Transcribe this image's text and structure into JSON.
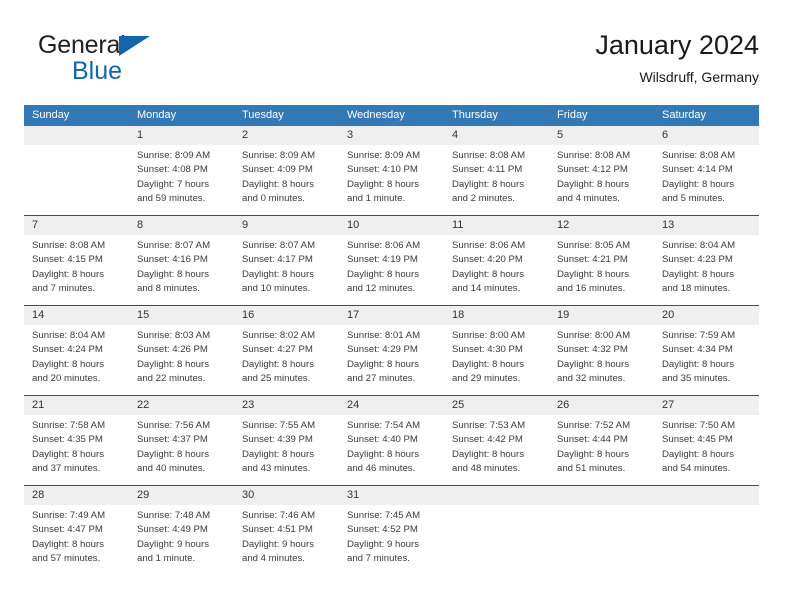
{
  "brand": {
    "word1": "General",
    "word2": "Blue",
    "flag_color": "#1266ab"
  },
  "header": {
    "title": "January 2024",
    "subtitle": "Wilsdruff, Germany"
  },
  "theme": {
    "header_blue": "#3379b8",
    "rule_blue": "#19598f",
    "daynum_band": "#efefef"
  },
  "calendar": {
    "weekdays": [
      "Sunday",
      "Monday",
      "Tuesday",
      "Wednesday",
      "Thursday",
      "Friday",
      "Saturday"
    ],
    "weeks": [
      [
        {
          "day": "",
          "sunrise": "",
          "sunset": "",
          "daylight1": "",
          "daylight2": ""
        },
        {
          "day": "1",
          "sunrise": "Sunrise: 8:09 AM",
          "sunset": "Sunset: 4:08 PM",
          "daylight1": "Daylight: 7 hours",
          "daylight2": "and 59 minutes."
        },
        {
          "day": "2",
          "sunrise": "Sunrise: 8:09 AM",
          "sunset": "Sunset: 4:09 PM",
          "daylight1": "Daylight: 8 hours",
          "daylight2": "and 0 minutes."
        },
        {
          "day": "3",
          "sunrise": "Sunrise: 8:09 AM",
          "sunset": "Sunset: 4:10 PM",
          "daylight1": "Daylight: 8 hours",
          "daylight2": "and 1 minute."
        },
        {
          "day": "4",
          "sunrise": "Sunrise: 8:08 AM",
          "sunset": "Sunset: 4:11 PM",
          "daylight1": "Daylight: 8 hours",
          "daylight2": "and 2 minutes."
        },
        {
          "day": "5",
          "sunrise": "Sunrise: 8:08 AM",
          "sunset": "Sunset: 4:12 PM",
          "daylight1": "Daylight: 8 hours",
          "daylight2": "and 4 minutes."
        },
        {
          "day": "6",
          "sunrise": "Sunrise: 8:08 AM",
          "sunset": "Sunset: 4:14 PM",
          "daylight1": "Daylight: 8 hours",
          "daylight2": "and 5 minutes."
        }
      ],
      [
        {
          "day": "7",
          "sunrise": "Sunrise: 8:08 AM",
          "sunset": "Sunset: 4:15 PM",
          "daylight1": "Daylight: 8 hours",
          "daylight2": "and 7 minutes."
        },
        {
          "day": "8",
          "sunrise": "Sunrise: 8:07 AM",
          "sunset": "Sunset: 4:16 PM",
          "daylight1": "Daylight: 8 hours",
          "daylight2": "and 8 minutes."
        },
        {
          "day": "9",
          "sunrise": "Sunrise: 8:07 AM",
          "sunset": "Sunset: 4:17 PM",
          "daylight1": "Daylight: 8 hours",
          "daylight2": "and 10 minutes."
        },
        {
          "day": "10",
          "sunrise": "Sunrise: 8:06 AM",
          "sunset": "Sunset: 4:19 PM",
          "daylight1": "Daylight: 8 hours",
          "daylight2": "and 12 minutes."
        },
        {
          "day": "11",
          "sunrise": "Sunrise: 8:06 AM",
          "sunset": "Sunset: 4:20 PM",
          "daylight1": "Daylight: 8 hours",
          "daylight2": "and 14 minutes."
        },
        {
          "day": "12",
          "sunrise": "Sunrise: 8:05 AM",
          "sunset": "Sunset: 4:21 PM",
          "daylight1": "Daylight: 8 hours",
          "daylight2": "and 16 minutes."
        },
        {
          "day": "13",
          "sunrise": "Sunrise: 8:04 AM",
          "sunset": "Sunset: 4:23 PM",
          "daylight1": "Daylight: 8 hours",
          "daylight2": "and 18 minutes."
        }
      ],
      [
        {
          "day": "14",
          "sunrise": "Sunrise: 8:04 AM",
          "sunset": "Sunset: 4:24 PM",
          "daylight1": "Daylight: 8 hours",
          "daylight2": "and 20 minutes."
        },
        {
          "day": "15",
          "sunrise": "Sunrise: 8:03 AM",
          "sunset": "Sunset: 4:26 PM",
          "daylight1": "Daylight: 8 hours",
          "daylight2": "and 22 minutes."
        },
        {
          "day": "16",
          "sunrise": "Sunrise: 8:02 AM",
          "sunset": "Sunset: 4:27 PM",
          "daylight1": "Daylight: 8 hours",
          "daylight2": "and 25 minutes."
        },
        {
          "day": "17",
          "sunrise": "Sunrise: 8:01 AM",
          "sunset": "Sunset: 4:29 PM",
          "daylight1": "Daylight: 8 hours",
          "daylight2": "and 27 minutes."
        },
        {
          "day": "18",
          "sunrise": "Sunrise: 8:00 AM",
          "sunset": "Sunset: 4:30 PM",
          "daylight1": "Daylight: 8 hours",
          "daylight2": "and 29 minutes."
        },
        {
          "day": "19",
          "sunrise": "Sunrise: 8:00 AM",
          "sunset": "Sunset: 4:32 PM",
          "daylight1": "Daylight: 8 hours",
          "daylight2": "and 32 minutes."
        },
        {
          "day": "20",
          "sunrise": "Sunrise: 7:59 AM",
          "sunset": "Sunset: 4:34 PM",
          "daylight1": "Daylight: 8 hours",
          "daylight2": "and 35 minutes."
        }
      ],
      [
        {
          "day": "21",
          "sunrise": "Sunrise: 7:58 AM",
          "sunset": "Sunset: 4:35 PM",
          "daylight1": "Daylight: 8 hours",
          "daylight2": "and 37 minutes."
        },
        {
          "day": "22",
          "sunrise": "Sunrise: 7:56 AM",
          "sunset": "Sunset: 4:37 PM",
          "daylight1": "Daylight: 8 hours",
          "daylight2": "and 40 minutes."
        },
        {
          "day": "23",
          "sunrise": "Sunrise: 7:55 AM",
          "sunset": "Sunset: 4:39 PM",
          "daylight1": "Daylight: 8 hours",
          "daylight2": "and 43 minutes."
        },
        {
          "day": "24",
          "sunrise": "Sunrise: 7:54 AM",
          "sunset": "Sunset: 4:40 PM",
          "daylight1": "Daylight: 8 hours",
          "daylight2": "and 46 minutes."
        },
        {
          "day": "25",
          "sunrise": "Sunrise: 7:53 AM",
          "sunset": "Sunset: 4:42 PM",
          "daylight1": "Daylight: 8 hours",
          "daylight2": "and 48 minutes."
        },
        {
          "day": "26",
          "sunrise": "Sunrise: 7:52 AM",
          "sunset": "Sunset: 4:44 PM",
          "daylight1": "Daylight: 8 hours",
          "daylight2": "and 51 minutes."
        },
        {
          "day": "27",
          "sunrise": "Sunrise: 7:50 AM",
          "sunset": "Sunset: 4:45 PM",
          "daylight1": "Daylight: 8 hours",
          "daylight2": "and 54 minutes."
        }
      ],
      [
        {
          "day": "28",
          "sunrise": "Sunrise: 7:49 AM",
          "sunset": "Sunset: 4:47 PM",
          "daylight1": "Daylight: 8 hours",
          "daylight2": "and 57 minutes."
        },
        {
          "day": "29",
          "sunrise": "Sunrise: 7:48 AM",
          "sunset": "Sunset: 4:49 PM",
          "daylight1": "Daylight: 9 hours",
          "daylight2": "and 1 minute."
        },
        {
          "day": "30",
          "sunrise": "Sunrise: 7:46 AM",
          "sunset": "Sunset: 4:51 PM",
          "daylight1": "Daylight: 9 hours",
          "daylight2": "and 4 minutes."
        },
        {
          "day": "31",
          "sunrise": "Sunrise: 7:45 AM",
          "sunset": "Sunset: 4:52 PM",
          "daylight1": "Daylight: 9 hours",
          "daylight2": "and 7 minutes."
        },
        {
          "day": "",
          "sunrise": "",
          "sunset": "",
          "daylight1": "",
          "daylight2": ""
        },
        {
          "day": "",
          "sunrise": "",
          "sunset": "",
          "daylight1": "",
          "daylight2": ""
        },
        {
          "day": "",
          "sunrise": "",
          "sunset": "",
          "daylight1": "",
          "daylight2": ""
        }
      ]
    ]
  }
}
